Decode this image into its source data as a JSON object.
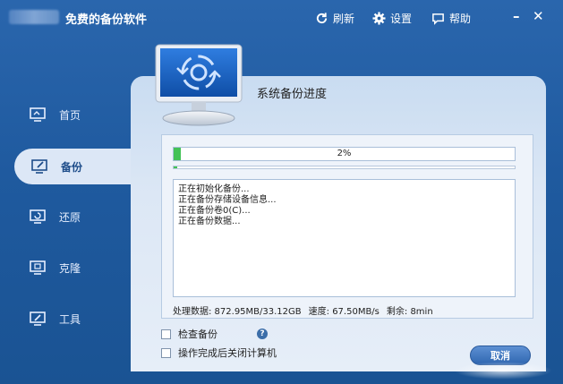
{
  "window": {
    "title": "免费的备份软件",
    "refresh_label": "刷新",
    "settings_label": "设置",
    "help_label": "帮助",
    "minimize_label": "–",
    "close_label": "✕"
  },
  "sidebar": {
    "items": [
      {
        "label": "首页",
        "icon": "home-icon"
      },
      {
        "label": "备份",
        "icon": "backup-icon",
        "active": true
      },
      {
        "label": "还原",
        "icon": "restore-icon"
      },
      {
        "label": "克隆",
        "icon": "clone-icon"
      },
      {
        "label": "工具",
        "icon": "tools-icon"
      }
    ]
  },
  "panel": {
    "title": "系统备份进度",
    "progress": {
      "value": 0.02,
      "label": "2%"
    },
    "sub_progress": {
      "value": 0.01
    },
    "log_lines": [
      "正在初始化备份...",
      "正在备份存储设备信息...",
      "正在备份卷0(C)...",
      "正在备份数据..."
    ],
    "stats": {
      "processed": "处理数据: 872.95MB/33.12GB",
      "speed": "速度: 67.50MB/s",
      "remaining": "剩余: 8min"
    },
    "options": {
      "verify_label": "检查备份",
      "shutdown_label": "操作完成后关闭计算机",
      "help_glyph": "?"
    },
    "cancel_label": "取消"
  },
  "colors": {
    "background": "#1f5a9f",
    "panel": "#dce7f5",
    "progress_fill": "#43c256",
    "button": "#3f78c2"
  }
}
